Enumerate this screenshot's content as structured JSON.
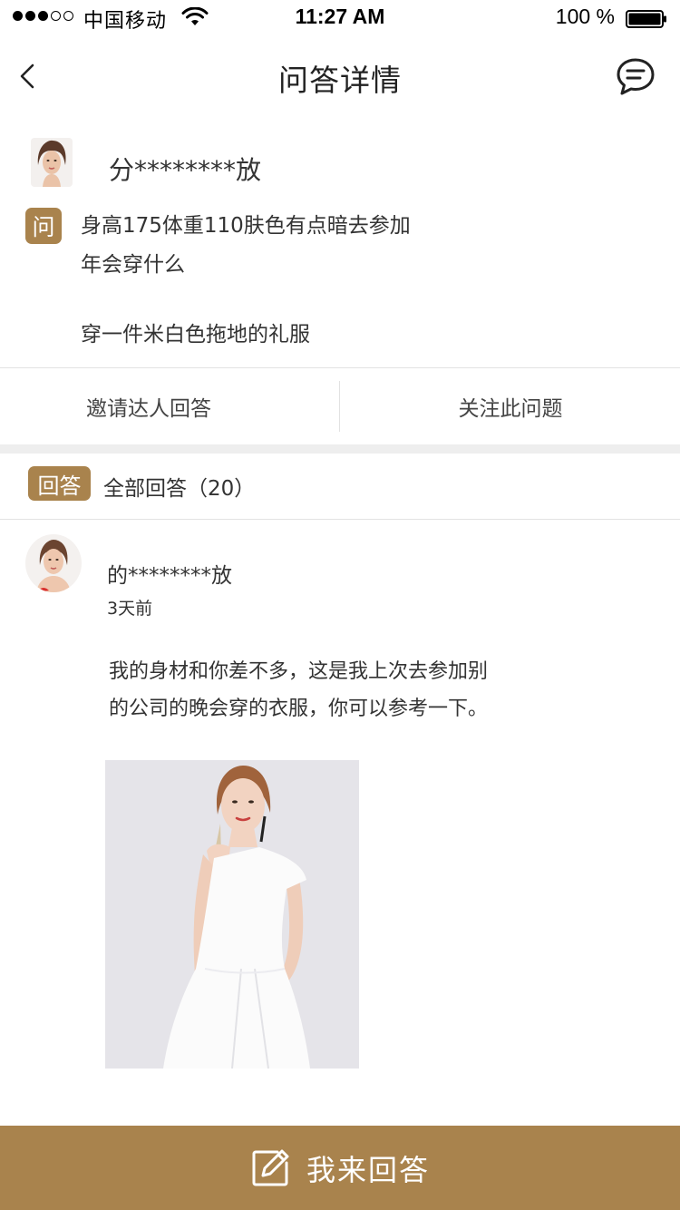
{
  "status_bar": {
    "carrier": "中国移动",
    "time": "11:27 AM",
    "battery": "100 %"
  },
  "nav": {
    "title": "问答详情",
    "back_icon": "chevron-left-icon",
    "message_icon": "chat-bubble-icon"
  },
  "question": {
    "username": "分********放",
    "badge": "问",
    "text_line1": "身高175体重110肤色有点暗去参加",
    "text_line2": "年会穿什么",
    "answer": "穿一件米白色拖地的礼服"
  },
  "actions": {
    "invite": "邀请达人回答",
    "follow": "关注此问题"
  },
  "answers": {
    "badge": "回答",
    "header": "全部回答（20）",
    "items": [
      {
        "username": "的********放",
        "time": "3天前",
        "text_line1": "我的身材和你差不多，这是我上次去参加别",
        "text_line2": "的公司的晚会穿的衣服，你可以参考一下。"
      }
    ]
  },
  "bottom": {
    "label": "我来回答",
    "icon": "edit-icon"
  },
  "colors": {
    "accent": "#a9834d",
    "divider": "#e2e2e2",
    "band": "#eeeeee"
  }
}
